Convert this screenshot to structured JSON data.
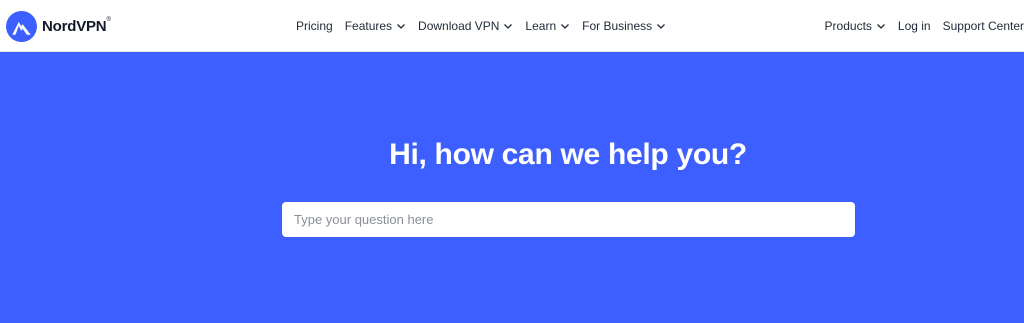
{
  "brand": {
    "name": "NordVPN",
    "trademark": "®",
    "color": "#3e5fff",
    "icon": "nordvpn-mountain-logo"
  },
  "nav": {
    "main": [
      {
        "label": "Pricing",
        "dropdown": false
      },
      {
        "label": "Features",
        "dropdown": true
      },
      {
        "label": "Download VPN",
        "dropdown": true
      },
      {
        "label": "Learn",
        "dropdown": true
      },
      {
        "label": "For Business",
        "dropdown": true
      }
    ],
    "right": [
      {
        "label": "Products",
        "dropdown": true
      },
      {
        "label": "Log in",
        "dropdown": false
      },
      {
        "label": "Support Center",
        "dropdown": false
      }
    ]
  },
  "hero": {
    "background": "#3e5fff",
    "title": "Hi, how can we help you?",
    "search": {
      "placeholder": "Type your question here",
      "value": ""
    }
  }
}
